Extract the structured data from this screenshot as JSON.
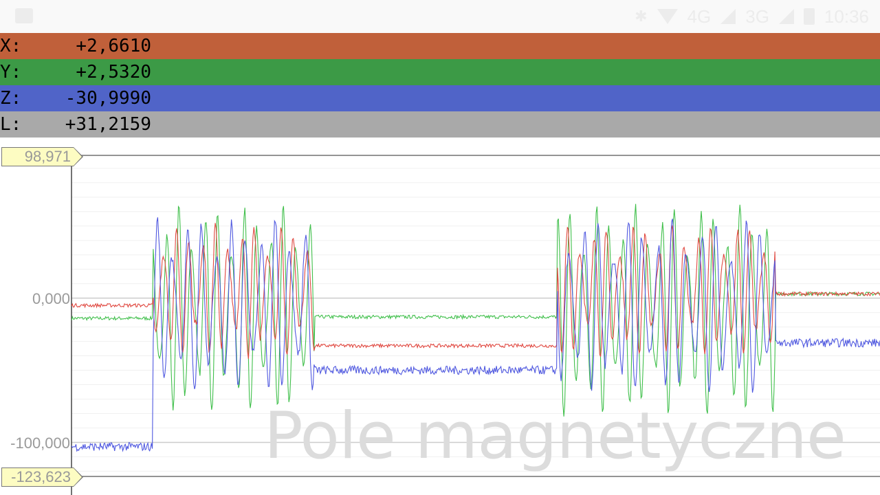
{
  "status_bar": {
    "network_1": "4G",
    "network_2": "3G",
    "time": "10:36",
    "icons": [
      "image-icon",
      "bluetooth-icon",
      "wifi-icon",
      "signal-icon",
      "battery-icon"
    ]
  },
  "readouts": [
    {
      "label": "X:",
      "value": "+2,6610",
      "color": "#c0603a"
    },
    {
      "label": "Y:",
      "value": "+2,5320",
      "color": "#3c9a46"
    },
    {
      "label": "Z:",
      "value": "-30,9990",
      "color": "#5064c8"
    },
    {
      "label": "L:",
      "value": "+31,2159",
      "color": "#a9a9a9"
    }
  ],
  "chart": {
    "max_label": "98,971",
    "zero_label": "0,000",
    "tick_label": "-100,000",
    "min_label": "-123,623",
    "title_watermark": "Pole magnetyczne"
  },
  "chart_data": {
    "type": "line",
    "ylim": [
      -123.623,
      98.971
    ],
    "grid": true,
    "series_colors": {
      "x": "#e0473f",
      "y": "#3fbf4a",
      "z": "#4f58e0"
    },
    "segments": [
      {
        "from": 0,
        "to": 0.1,
        "x": -5,
        "y": -14,
        "z": -103
      },
      {
        "from": 0.1,
        "to": 0.3,
        "x": "oscillating",
        "y": "oscillating",
        "z": "oscillating"
      },
      {
        "from": 0.3,
        "to": 0.6,
        "x": -33,
        "y": -13,
        "z": -50
      },
      {
        "from": 0.6,
        "to": 0.87,
        "x": "oscillating",
        "y": "oscillating",
        "z": "oscillating"
      },
      {
        "from": 0.87,
        "to": 1.0,
        "x": 3,
        "y": 3,
        "z": -31
      }
    ]
  }
}
